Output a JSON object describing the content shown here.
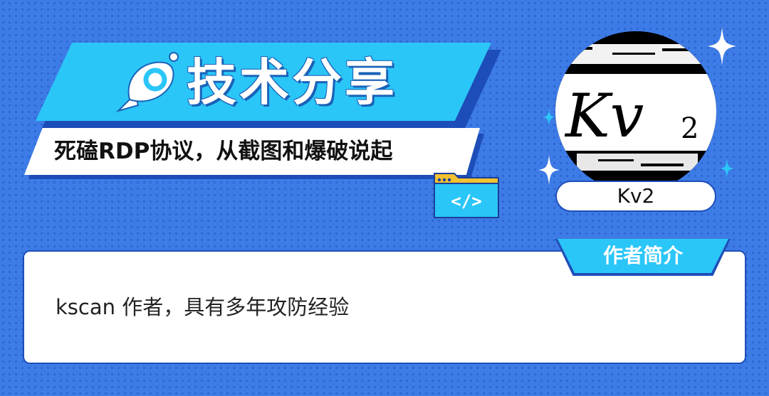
{
  "banner": {
    "title": "技术分享",
    "subtitle": "死磕RDP协议，从截图和爆破说起"
  },
  "code_icon": {
    "glyph": "</>"
  },
  "avatar": {
    "image_text_main": "Kv",
    "image_text_sub": "2"
  },
  "author": {
    "name": "Kv2",
    "intro_tab": "作者简介",
    "intro_text": "kscan 作者，具有多年攻防经验"
  },
  "colors": {
    "background": "#3d7be6",
    "accent_cyan": "#2bc6f8",
    "accent_dark_blue": "#1d4db8",
    "folder_yellow": "#f2c230"
  }
}
